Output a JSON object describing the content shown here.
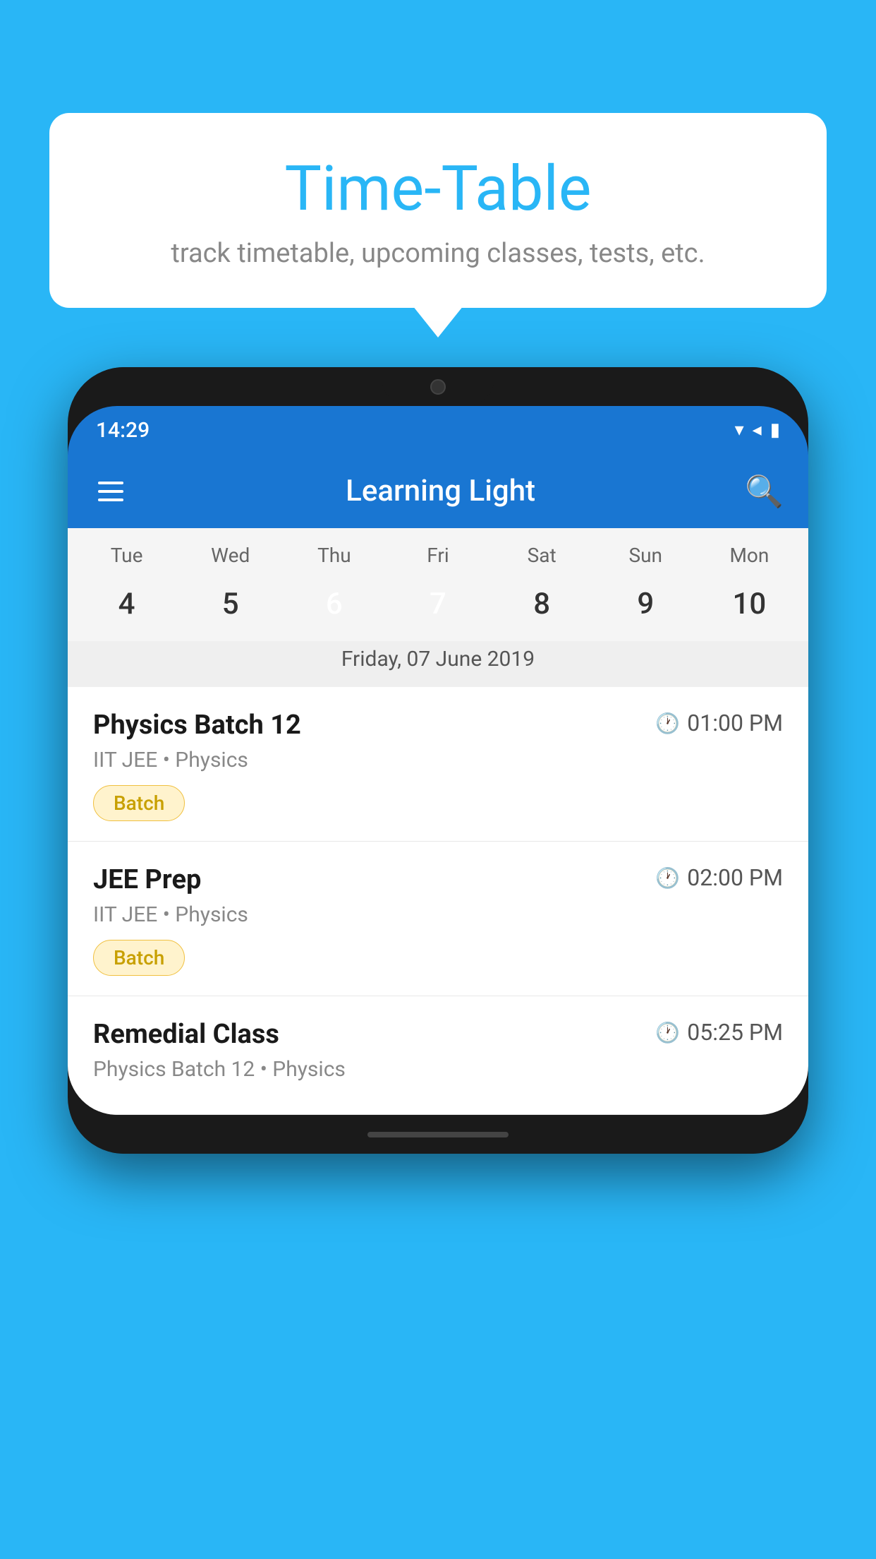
{
  "background": {
    "color": "#29B6F6"
  },
  "speech_bubble": {
    "title": "Time-Table",
    "subtitle": "track timetable, upcoming classes, tests, etc."
  },
  "phone": {
    "status_bar": {
      "time": "14:29",
      "wifi_icon": "wifi",
      "signal_icon": "signal",
      "battery_icon": "battery"
    },
    "toolbar": {
      "title": "Learning Light",
      "menu_icon": "menu",
      "search_icon": "search"
    },
    "calendar": {
      "days": [
        "Tue",
        "Wed",
        "Thu",
        "Fri",
        "Sat",
        "Sun",
        "Mon"
      ],
      "dates": [
        {
          "num": "4",
          "state": "normal"
        },
        {
          "num": "5",
          "state": "normal"
        },
        {
          "num": "6",
          "state": "today-green"
        },
        {
          "num": "7",
          "state": "today-blue"
        },
        {
          "num": "8",
          "state": "normal"
        },
        {
          "num": "9",
          "state": "normal"
        },
        {
          "num": "10",
          "state": "normal"
        }
      ],
      "selected_date": "Friday, 07 June 2019"
    },
    "schedule": [
      {
        "title": "Physics Batch 12",
        "time": "01:00 PM",
        "sub": "IIT JEE • Physics",
        "badge": "Batch"
      },
      {
        "title": "JEE Prep",
        "time": "02:00 PM",
        "sub": "IIT JEE • Physics",
        "badge": "Batch"
      },
      {
        "title": "Remedial Class",
        "time": "05:25 PM",
        "sub": "Physics Batch 12 • Physics",
        "badge": null
      }
    ]
  }
}
